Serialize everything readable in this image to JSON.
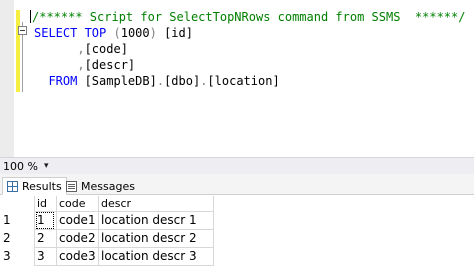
{
  "editor": {
    "lines": [
      {
        "segments": [
          {
            "text": "/****** Script for SelectTopNRows command from SSMS  ******/",
            "cls": "comment"
          }
        ]
      },
      {
        "segments": [
          {
            "text": "SELECT ",
            "cls": "kw"
          },
          {
            "text": "TOP ",
            "cls": "kw"
          },
          {
            "text": "(",
            "cls": "gray"
          },
          {
            "text": "1000",
            "cls": "plain"
          },
          {
            "text": ") ",
            "cls": "gray"
          },
          {
            "text": "[id]",
            "cls": "plain"
          }
        ]
      },
      {
        "segments": [
          {
            "text": "      ,",
            "cls": "gray"
          },
          {
            "text": "[code]",
            "cls": "plain"
          }
        ]
      },
      {
        "segments": [
          {
            "text": "      ,",
            "cls": "gray"
          },
          {
            "text": "[descr]",
            "cls": "plain"
          }
        ]
      },
      {
        "segments": [
          {
            "text": "  FROM ",
            "cls": "kw"
          },
          {
            "text": "[SampleDB]",
            "cls": "plain"
          },
          {
            "text": ".",
            "cls": "gray"
          },
          {
            "text": "[dbo]",
            "cls": "plain"
          },
          {
            "text": ".",
            "cls": "gray"
          },
          {
            "text": "[location]",
            "cls": "plain"
          }
        ]
      }
    ]
  },
  "zoom": {
    "value": "100 %"
  },
  "tabs": {
    "results": "Results",
    "messages": "Messages"
  },
  "results": {
    "columns": [
      "id",
      "code",
      "descr"
    ],
    "rows": [
      {
        "rownum": "1",
        "id": "1",
        "code": "code1",
        "descr": "location descr 1"
      },
      {
        "rownum": "2",
        "id": "2",
        "code": "code2",
        "descr": "location descr 2"
      },
      {
        "rownum": "3",
        "id": "3",
        "code": "code3",
        "descr": "location descr 3"
      }
    ]
  }
}
